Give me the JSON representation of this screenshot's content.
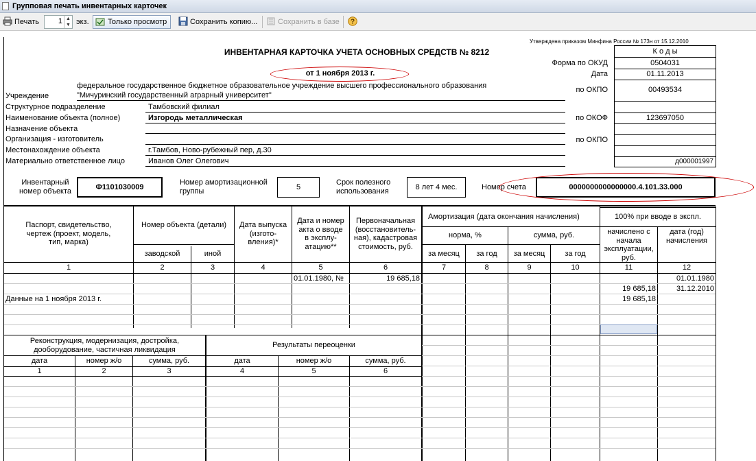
{
  "window": {
    "title": "Групповая печать инвентарных карточек"
  },
  "toolbar": {
    "print_label": "Печать",
    "copies_value": "1",
    "copies_unit": "экз.",
    "view_only_label": "Только просмотр",
    "save_copy_label": "Сохранить копию...",
    "save_db_label": "Сохранить в базе"
  },
  "card": {
    "approval": "Утверждена приказом Минфина России  № 173н от 15.12.2010",
    "title": "ИНВЕНТАРНАЯ КАРТОЧКА УЧЕТА ОСНОВНЫХ СРЕДСТВ  №  8212",
    "date_line": "от 1 ноября 2013 г.",
    "codes_header": "К о д ы",
    "okud_label": "Форма по ОКУД",
    "okud_value": "0504031",
    "date_label": "Дата",
    "date_value": "01.11.2013",
    "okpo_label": "по ОКПО",
    "okpo_value": "00493534",
    "okof_label": "по ОКОФ",
    "okof_value": "123697050",
    "okpo2_label": "по ОКПО",
    "mol_code": "д000001997",
    "institution_label": "Учреждение",
    "institution_line1": "федеральное государственное бюджетное образовательное учреждение высшего профессионального образования",
    "institution_line2": "\"Мичуринский государственный аграрный университет\"",
    "division_label": "Структурное подразделение",
    "division_value": "Тамбовский филиал",
    "name_label": "Наименование объекта (полное)",
    "name_value": "Изгородь металлическая",
    "purpose_label": "Назначение объекта",
    "maker_label": "Организация - изготовитель",
    "location_label": "Местонахождение объекта",
    "location_value": "г.Тамбов, Ново-рубежный пер, д.30",
    "mol_label": "Материально ответственное лицо",
    "mol_value": "Иванов Олег Олегович",
    "inv_label_1": "Инвентарный",
    "inv_label_2": "номер объекта",
    "inv_value": "Ф1101030009",
    "amort_group_label_1": "Номер амортизационной",
    "amort_group_label_2": "группы",
    "amort_group_value": "5",
    "life_label_1": "Срок полезного",
    "life_label_2": "использования",
    "life_value": "8 лет 4 мес.",
    "account_label": "Номер счета",
    "account_value": "0000000000000000.4.101.33.000"
  },
  "table1": {
    "h_passport": [
      "Паспорт, свидетельство,",
      "чертеж (проект, модель,",
      "тип, марка)"
    ],
    "h_objnum": "Номер объекта (детали)",
    "h_factory": "заводской",
    "h_other": "иной",
    "h_release": [
      "Дата выпуска",
      "(изгото-",
      "вления)*"
    ],
    "h_act": [
      "Дата и номер",
      "акта о вводе",
      "в эксплу-",
      "атацию**"
    ],
    "h_initial": [
      "Первоначальная",
      "(восстановитель-",
      "ная), кадастровая",
      "стоимость, руб."
    ],
    "h_amort": "Амортизация      (дата окончания начисления)",
    "h_100": "100% при вводе в экспл.",
    "h_norm": "норма, %",
    "h_sum": "сумма, руб.",
    "h_per_month": "за месяц",
    "h_per_year": "за год",
    "h_accrued": [
      "начислено с",
      "начала",
      "эксплуатации,",
      "руб."
    ],
    "h_accrual_date": [
      "дата (год)",
      "начисления"
    ],
    "col_numbers": [
      "1",
      "2",
      "3",
      "4",
      "5",
      "6",
      "7",
      "8",
      "9",
      "10",
      "11",
      "12"
    ],
    "row1_act": "01.01.1980, №",
    "row1_initial": "19 685,18",
    "row1_date": "01.01.1980",
    "row2_accrued": "19 685,18",
    "row2_date": "31.12.2010",
    "row3_label": "Данные на 1 ноября 2013 г.",
    "row3_accrued": "19 685,18"
  },
  "table2": {
    "h_recon": [
      "Реконструкция, модернизация, достройка,",
      "дооборудование, частичная ликвидация"
    ],
    "h_reval": "Результаты переоценки",
    "h_date": "дата",
    "h_num": "номер ж/о",
    "h_sum": "сумма, руб.",
    "col_numbers": [
      "1",
      "2",
      "3",
      "4",
      "5",
      "6"
    ]
  },
  "colors": {
    "annotation": "#cc0000",
    "selected_cell": "#dfe7f3"
  }
}
